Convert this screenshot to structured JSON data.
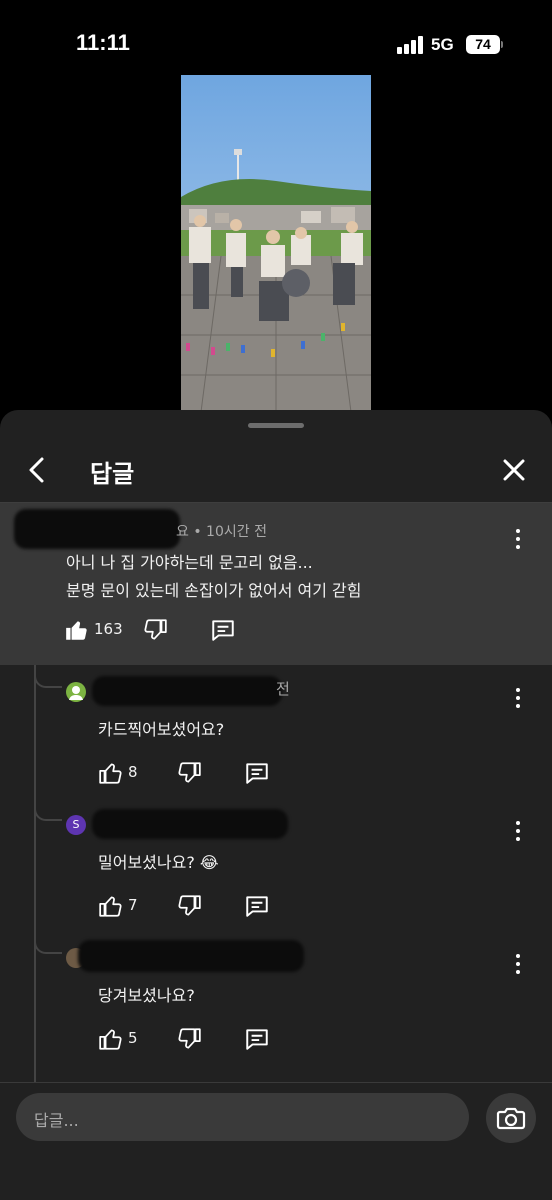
{
  "status_bar": {
    "time": "11:11",
    "network": "5G",
    "battery": "74"
  },
  "header": {
    "title": "답글"
  },
  "comment": {
    "meta": "요 • 10시간 전",
    "lines": [
      "아니 나 집 가야하는데 문고리 없음...",
      "분명 문이 있는데 손잡이가 없어서 여기 갇힘"
    ],
    "likes": "163"
  },
  "replies": [
    {
      "name_tail": "전",
      "avatar_letter": "",
      "avatar_color": "#7cb342",
      "text": "카드찍어보셨어요?",
      "likes": "8"
    },
    {
      "name_tail": "",
      "avatar_letter": "S",
      "avatar_color": "#5e35b1",
      "text": "밀어보셨나요? 😂",
      "likes": "7"
    },
    {
      "name_tail": "",
      "avatar_letter": "",
      "avatar_color": "#6d5a45",
      "text": "당겨보셨나요?",
      "likes": "5"
    }
  ],
  "input": {
    "placeholder": "답글..."
  },
  "icons": [
    "back-arrow-icon",
    "close-icon",
    "more-vert-icon",
    "thumb-up-icon",
    "thumb-down-icon",
    "comment-icon",
    "camera-icon"
  ]
}
